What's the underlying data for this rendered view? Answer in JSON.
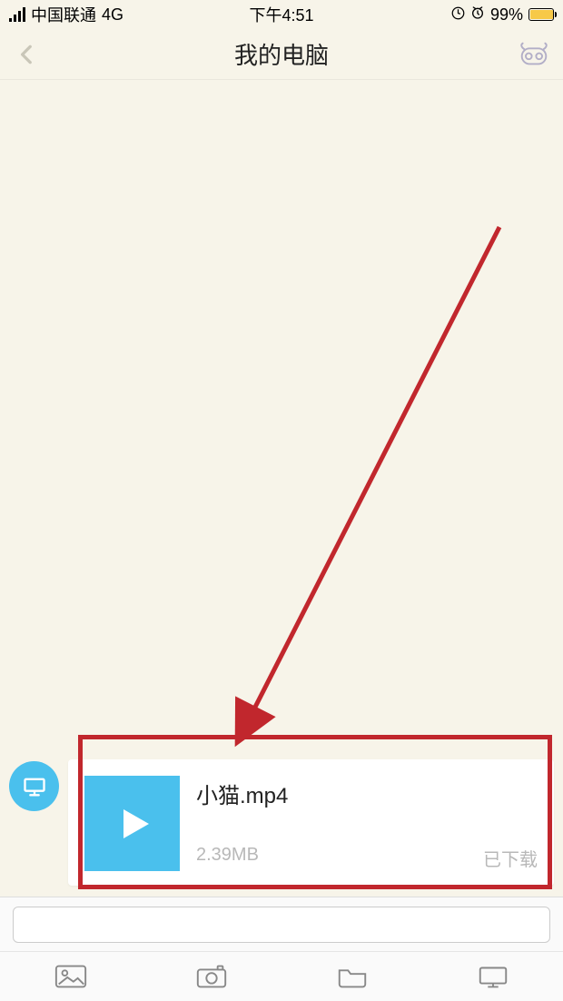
{
  "status": {
    "carrier": "中国联通",
    "network": "4G",
    "time": "下午4:51",
    "battery_percent": "99%"
  },
  "header": {
    "title": "我的电脑"
  },
  "message": {
    "file_name": "小猫.mp4",
    "file_size": "2.39MB",
    "download_status": "已下载"
  },
  "colors": {
    "accent": "#4ac0ed",
    "highlight": "#c1272d",
    "bg": "#f7f4e9"
  }
}
